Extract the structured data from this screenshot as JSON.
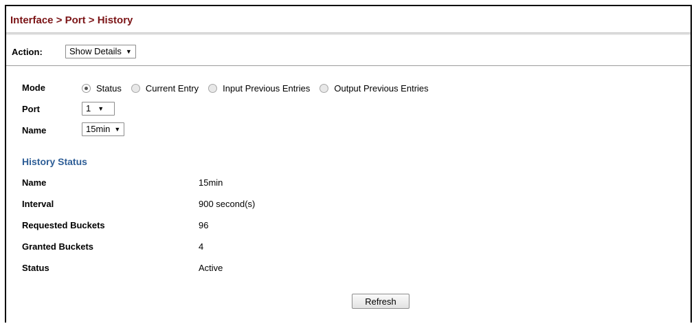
{
  "breadcrumb": "Interface > Port > History",
  "action": {
    "label": "Action:",
    "selected": "Show Details"
  },
  "mode": {
    "label": "Mode",
    "options": [
      "Status",
      "Current Entry",
      "Input Previous Entries",
      "Output Previous Entries"
    ],
    "selected": "Status"
  },
  "port": {
    "label": "Port",
    "selected": "1"
  },
  "name": {
    "label": "Name",
    "selected": "15min"
  },
  "history_status": {
    "title": "History Status",
    "rows": [
      {
        "label": "Name",
        "value": "15min"
      },
      {
        "label": "Interval",
        "value": "900 second(s)"
      },
      {
        "label": "Requested Buckets",
        "value": "96"
      },
      {
        "label": "Granted Buckets",
        "value": "4"
      },
      {
        "label": "Status",
        "value": "Active"
      }
    ]
  },
  "refresh_label": "Refresh",
  "colors": {
    "title": "#7b1416",
    "section": "#2d5d96"
  },
  "icons": {
    "dropdown": "chevron-down-icon"
  }
}
